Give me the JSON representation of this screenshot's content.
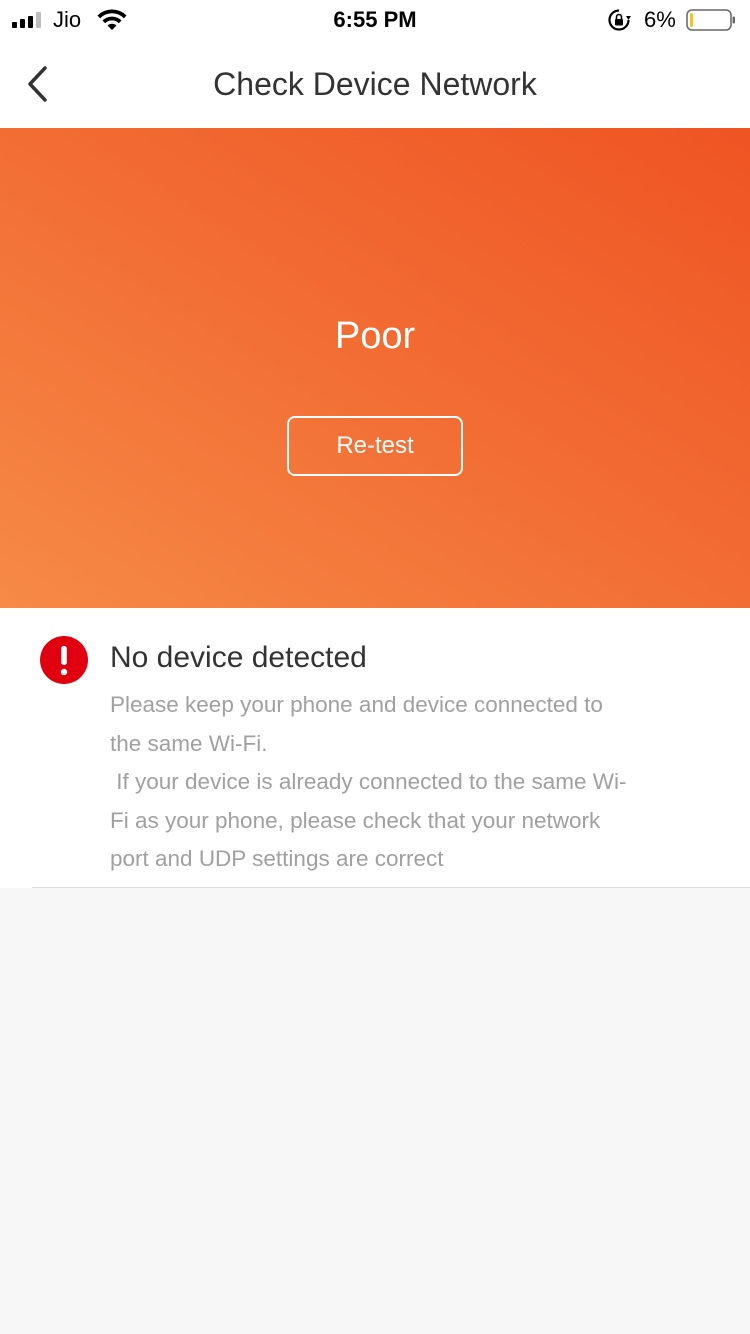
{
  "status_bar": {
    "carrier": "Jio",
    "time": "6:55 PM",
    "battery_percent": "6%",
    "signal_icon": "signal-bars-icon",
    "wifi_icon": "wifi-icon",
    "lock_icon": "orientation-lock-icon",
    "battery_icon": "battery-icon",
    "battery_level": 0.06
  },
  "nav": {
    "title": "Check Device Network",
    "back_icon": "chevron-left-icon"
  },
  "hero": {
    "quality_label": "Poor",
    "retest_label": "Re-test",
    "gradient_colors": [
      "#f68a46",
      "#ef5423"
    ]
  },
  "result": {
    "icon": "alert-icon",
    "icon_color": "#e0000f",
    "title": "No device detected",
    "description_lines": [
      "Please keep your phone and device connected to",
      "the same Wi-Fi.",
      " If your device is already connected to the same Wi-",
      "Fi as your phone, please check that your network",
      "port and UDP settings are correct"
    ]
  }
}
